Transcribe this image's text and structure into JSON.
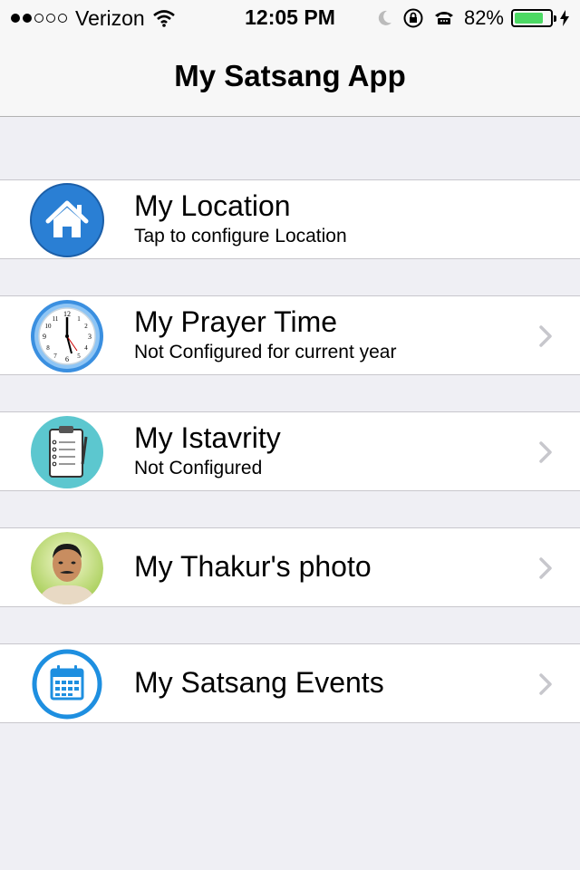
{
  "status": {
    "carrier": "Verizon",
    "time": "12:05 PM",
    "battery": "82%",
    "battery_level": 0.82,
    "signal_bars_filled": 2,
    "signal_bars_total": 5
  },
  "nav": {
    "title": "My Satsang App"
  },
  "colors": {
    "battery_green": "#4cd964",
    "chevron": "#c7c7cc",
    "icon_blue": "#2a7fd4"
  },
  "menu": [
    {
      "title": "My Location",
      "subtitle": "Tap to configure Location",
      "icon": "home-icon",
      "chevron": false
    },
    {
      "title": "My Prayer Time",
      "subtitle": "Not Configured for current year",
      "icon": "clock-icon",
      "chevron": true
    },
    {
      "title": "My Istavrity",
      "subtitle": "Not Configured",
      "icon": "clipboard-icon",
      "chevron": true
    },
    {
      "title": "My Thakur's photo",
      "subtitle": "",
      "icon": "portrait-photo",
      "chevron": true
    },
    {
      "title": "My Satsang Events",
      "subtitle": "",
      "icon": "calendar-icon",
      "chevron": true
    }
  ]
}
